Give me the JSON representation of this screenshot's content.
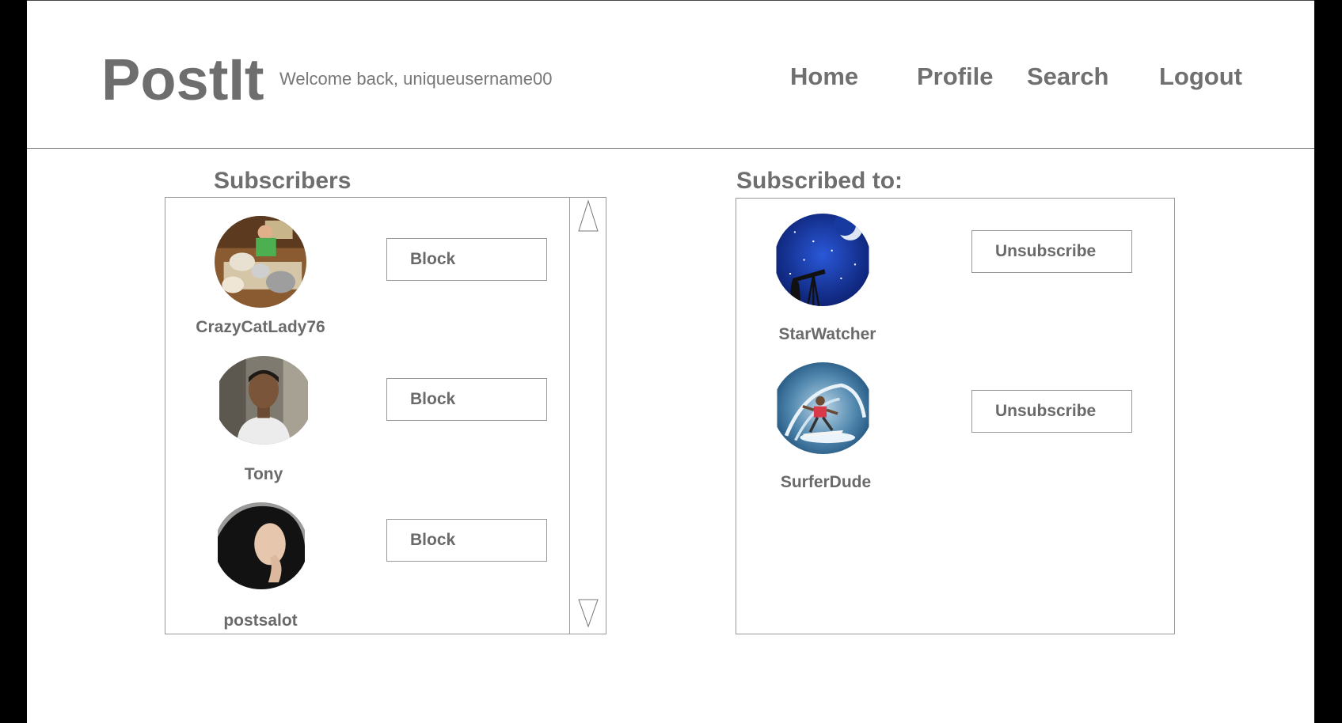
{
  "app": {
    "logo": "PostIt",
    "welcome": "Welcome back, uniqueusername00"
  },
  "nav": {
    "home": "Home",
    "profile": "Profile",
    "search": "Search",
    "logout": "Logout"
  },
  "subscribers": {
    "title": "Subscribers",
    "items": [
      {
        "username": "CrazyCatLady76",
        "action": "Block",
        "avatar": "cats-photo"
      },
      {
        "username": "Tony",
        "action": "Block",
        "avatar": "man-portrait"
      },
      {
        "username": "postsalot",
        "action": "Block",
        "avatar": "woman-portrait"
      }
    ]
  },
  "subscribed_to": {
    "title": "Subscribed to:",
    "items": [
      {
        "username": "StarWatcher",
        "action": "Unsubscribe",
        "avatar": "telescope-night-sky"
      },
      {
        "username": "SurferDude",
        "action": "Unsubscribe",
        "avatar": "surfer-wave"
      }
    ]
  },
  "colors": {
    "text": "#6e6e6e",
    "border": "#999999",
    "background": "#ffffff",
    "outer": "#000000"
  }
}
